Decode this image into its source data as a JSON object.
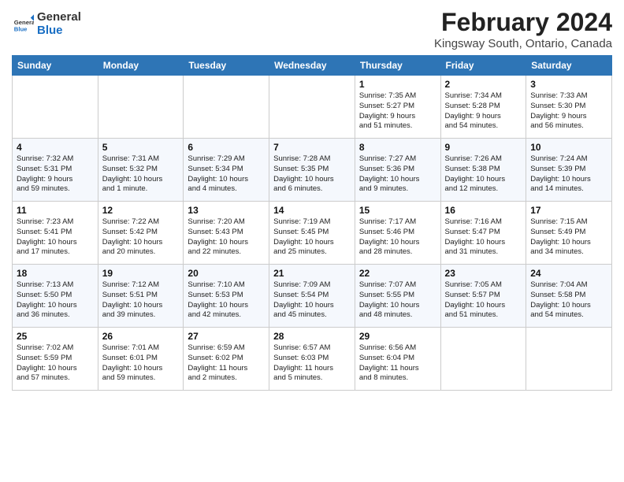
{
  "header": {
    "logo_line1": "General",
    "logo_line2": "Blue",
    "month_title": "February 2024",
    "subtitle": "Kingsway South, Ontario, Canada"
  },
  "columns": [
    "Sunday",
    "Monday",
    "Tuesday",
    "Wednesday",
    "Thursday",
    "Friday",
    "Saturday"
  ],
  "weeks": [
    [
      {
        "day": "",
        "info": ""
      },
      {
        "day": "",
        "info": ""
      },
      {
        "day": "",
        "info": ""
      },
      {
        "day": "",
        "info": ""
      },
      {
        "day": "1",
        "info": "Sunrise: 7:35 AM\nSunset: 5:27 PM\nDaylight: 9 hours\nand 51 minutes."
      },
      {
        "day": "2",
        "info": "Sunrise: 7:34 AM\nSunset: 5:28 PM\nDaylight: 9 hours\nand 54 minutes."
      },
      {
        "day": "3",
        "info": "Sunrise: 7:33 AM\nSunset: 5:30 PM\nDaylight: 9 hours\nand 56 minutes."
      }
    ],
    [
      {
        "day": "4",
        "info": "Sunrise: 7:32 AM\nSunset: 5:31 PM\nDaylight: 9 hours\nand 59 minutes."
      },
      {
        "day": "5",
        "info": "Sunrise: 7:31 AM\nSunset: 5:32 PM\nDaylight: 10 hours\nand 1 minute."
      },
      {
        "day": "6",
        "info": "Sunrise: 7:29 AM\nSunset: 5:34 PM\nDaylight: 10 hours\nand 4 minutes."
      },
      {
        "day": "7",
        "info": "Sunrise: 7:28 AM\nSunset: 5:35 PM\nDaylight: 10 hours\nand 6 minutes."
      },
      {
        "day": "8",
        "info": "Sunrise: 7:27 AM\nSunset: 5:36 PM\nDaylight: 10 hours\nand 9 minutes."
      },
      {
        "day": "9",
        "info": "Sunrise: 7:26 AM\nSunset: 5:38 PM\nDaylight: 10 hours\nand 12 minutes."
      },
      {
        "day": "10",
        "info": "Sunrise: 7:24 AM\nSunset: 5:39 PM\nDaylight: 10 hours\nand 14 minutes."
      }
    ],
    [
      {
        "day": "11",
        "info": "Sunrise: 7:23 AM\nSunset: 5:41 PM\nDaylight: 10 hours\nand 17 minutes."
      },
      {
        "day": "12",
        "info": "Sunrise: 7:22 AM\nSunset: 5:42 PM\nDaylight: 10 hours\nand 20 minutes."
      },
      {
        "day": "13",
        "info": "Sunrise: 7:20 AM\nSunset: 5:43 PM\nDaylight: 10 hours\nand 22 minutes."
      },
      {
        "day": "14",
        "info": "Sunrise: 7:19 AM\nSunset: 5:45 PM\nDaylight: 10 hours\nand 25 minutes."
      },
      {
        "day": "15",
        "info": "Sunrise: 7:17 AM\nSunset: 5:46 PM\nDaylight: 10 hours\nand 28 minutes."
      },
      {
        "day": "16",
        "info": "Sunrise: 7:16 AM\nSunset: 5:47 PM\nDaylight: 10 hours\nand 31 minutes."
      },
      {
        "day": "17",
        "info": "Sunrise: 7:15 AM\nSunset: 5:49 PM\nDaylight: 10 hours\nand 34 minutes."
      }
    ],
    [
      {
        "day": "18",
        "info": "Sunrise: 7:13 AM\nSunset: 5:50 PM\nDaylight: 10 hours\nand 36 minutes."
      },
      {
        "day": "19",
        "info": "Sunrise: 7:12 AM\nSunset: 5:51 PM\nDaylight: 10 hours\nand 39 minutes."
      },
      {
        "day": "20",
        "info": "Sunrise: 7:10 AM\nSunset: 5:53 PM\nDaylight: 10 hours\nand 42 minutes."
      },
      {
        "day": "21",
        "info": "Sunrise: 7:09 AM\nSunset: 5:54 PM\nDaylight: 10 hours\nand 45 minutes."
      },
      {
        "day": "22",
        "info": "Sunrise: 7:07 AM\nSunset: 5:55 PM\nDaylight: 10 hours\nand 48 minutes."
      },
      {
        "day": "23",
        "info": "Sunrise: 7:05 AM\nSunset: 5:57 PM\nDaylight: 10 hours\nand 51 minutes."
      },
      {
        "day": "24",
        "info": "Sunrise: 7:04 AM\nSunset: 5:58 PM\nDaylight: 10 hours\nand 54 minutes."
      }
    ],
    [
      {
        "day": "25",
        "info": "Sunrise: 7:02 AM\nSunset: 5:59 PM\nDaylight: 10 hours\nand 57 minutes."
      },
      {
        "day": "26",
        "info": "Sunrise: 7:01 AM\nSunset: 6:01 PM\nDaylight: 10 hours\nand 59 minutes."
      },
      {
        "day": "27",
        "info": "Sunrise: 6:59 AM\nSunset: 6:02 PM\nDaylight: 11 hours\nand 2 minutes."
      },
      {
        "day": "28",
        "info": "Sunrise: 6:57 AM\nSunset: 6:03 PM\nDaylight: 11 hours\nand 5 minutes."
      },
      {
        "day": "29",
        "info": "Sunrise: 6:56 AM\nSunset: 6:04 PM\nDaylight: 11 hours\nand 8 minutes."
      },
      {
        "day": "",
        "info": ""
      },
      {
        "day": "",
        "info": ""
      }
    ]
  ]
}
